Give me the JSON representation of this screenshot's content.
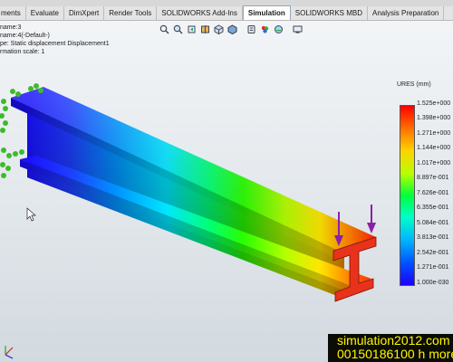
{
  "tabs": [
    {
      "label": "ments",
      "active": false
    },
    {
      "label": "Evaluate",
      "active": false
    },
    {
      "label": "DimXpert",
      "active": false
    },
    {
      "label": "Render Tools",
      "active": false
    },
    {
      "label": "SOLIDWORKS Add-Ins",
      "active": false
    },
    {
      "label": "Simulation",
      "active": true
    },
    {
      "label": "SOLIDWORKS MBD",
      "active": false
    },
    {
      "label": "Analysis Preparation",
      "active": false
    }
  ],
  "view_toolbar_icons": [
    "zoom-to-fit-icon",
    "zoom-area-icon",
    "previous-view-icon",
    "section-view-icon",
    "view-orientation-icon",
    "display-style-icon",
    "hide-show-icon",
    "appearance-icon",
    "scene-icon",
    "display-settings-icon"
  ],
  "study_info": {
    "line1": " name:3",
    "line2": "name:4(-Default-)",
    "line3": "pe: Static displacement Displacement1",
    "line4": "rmation scale: 1"
  },
  "legend": {
    "title": "URES (mm)",
    "labels": [
      "1.525e+000",
      "1.398e+000",
      "1.271e+000",
      "1.144e+000",
      "1.017e+000",
      "8.897e-001",
      "7.626e-001",
      "6.355e-001",
      "5.084e-001",
      "3.813e-001",
      "2.542e-001",
      "1.271e-001",
      "1.000e-030"
    ]
  },
  "watermark": {
    "line1": "simulation2012.com",
    "line2": "00150186100 h moreo"
  },
  "colors": {
    "active_tab": "#ffffff",
    "load_arrow": "#8b1fa8",
    "fixture": "#3dbb2a"
  }
}
